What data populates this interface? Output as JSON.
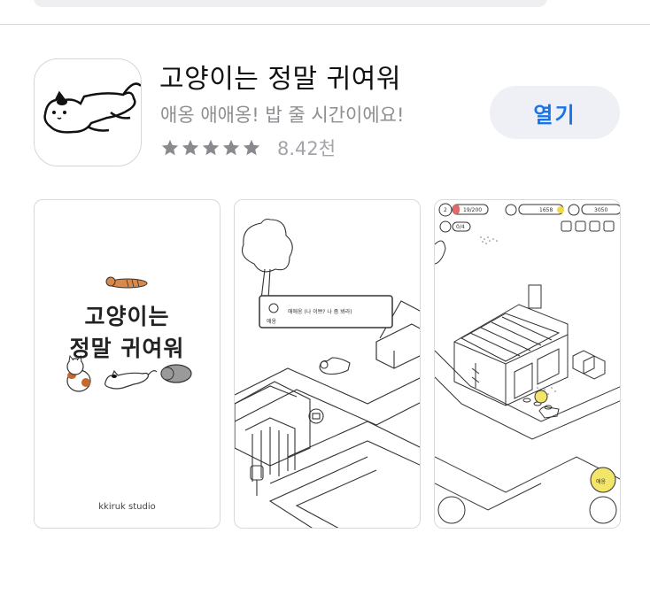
{
  "app": {
    "title": "고양이는 정말 귀여워",
    "subtitle": "애옹 애애옹! 밥 줄 시간이에요!",
    "rating_stars": 5,
    "rating_count": "8.42천",
    "open_label": "열기"
  },
  "screenshots": {
    "one": {
      "title_line1": "고양이는",
      "title_line2": "정말 귀여워",
      "studio": "kkiruk studio"
    },
    "two": {
      "dialog_name": "애옹",
      "dialog_text": "애애옹 (나 이쁘? 나 좀 봐라)"
    },
    "three": {
      "level": "2",
      "progress": "19/200",
      "counter": "0/4",
      "currency1": "1658",
      "currency2": "3050",
      "feed_label": "애옹"
    }
  },
  "colors": {
    "star": "#8a8a8e",
    "button_bg": "#eef0f6",
    "button_text": "#1a73e8",
    "subtitle": "#8e8e93"
  }
}
